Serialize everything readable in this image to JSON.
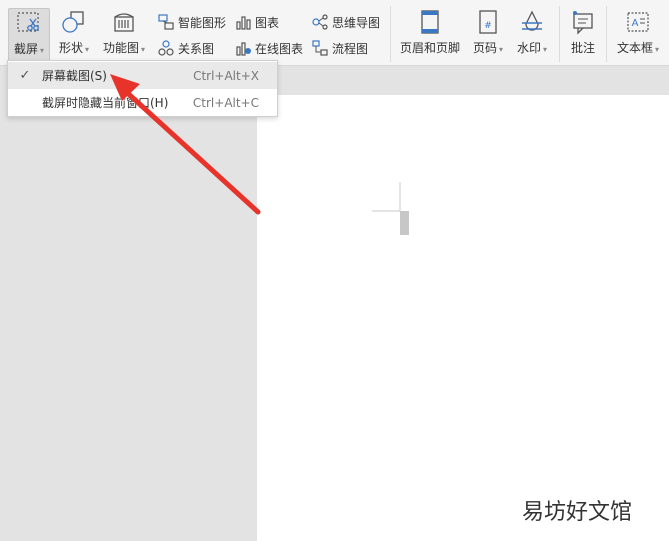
{
  "ribbon": {
    "screenshot": {
      "label": "截屏"
    },
    "shape": {
      "label": "形状"
    },
    "function_chart": {
      "label": "功能图"
    },
    "smart_graphic": {
      "label": "智能图形"
    },
    "relation_chart": {
      "label": "关系图"
    },
    "chart": {
      "label": "图表"
    },
    "online_chart": {
      "label": "在线图表"
    },
    "mind_map": {
      "label": "思维导图"
    },
    "flowchart": {
      "label": "流程图"
    },
    "header_footer": {
      "label": "页眉和页脚"
    },
    "page_number": {
      "label": "页码"
    },
    "watermark": {
      "label": "水印"
    },
    "comment": {
      "label": "批注"
    },
    "text_box": {
      "label": "文本框"
    }
  },
  "dropdown": {
    "items": [
      {
        "label": "屏幕截图(S)",
        "shortcut": "Ctrl+Alt+X",
        "checked": true
      },
      {
        "label": "截屏时隐藏当前窗口(H)",
        "shortcut": "Ctrl+Alt+C",
        "checked": false
      }
    ]
  },
  "watermark_text": "易坊好文馆",
  "colors": {
    "arrow": "#e8332a",
    "accent_blue": "#3b78c4"
  }
}
